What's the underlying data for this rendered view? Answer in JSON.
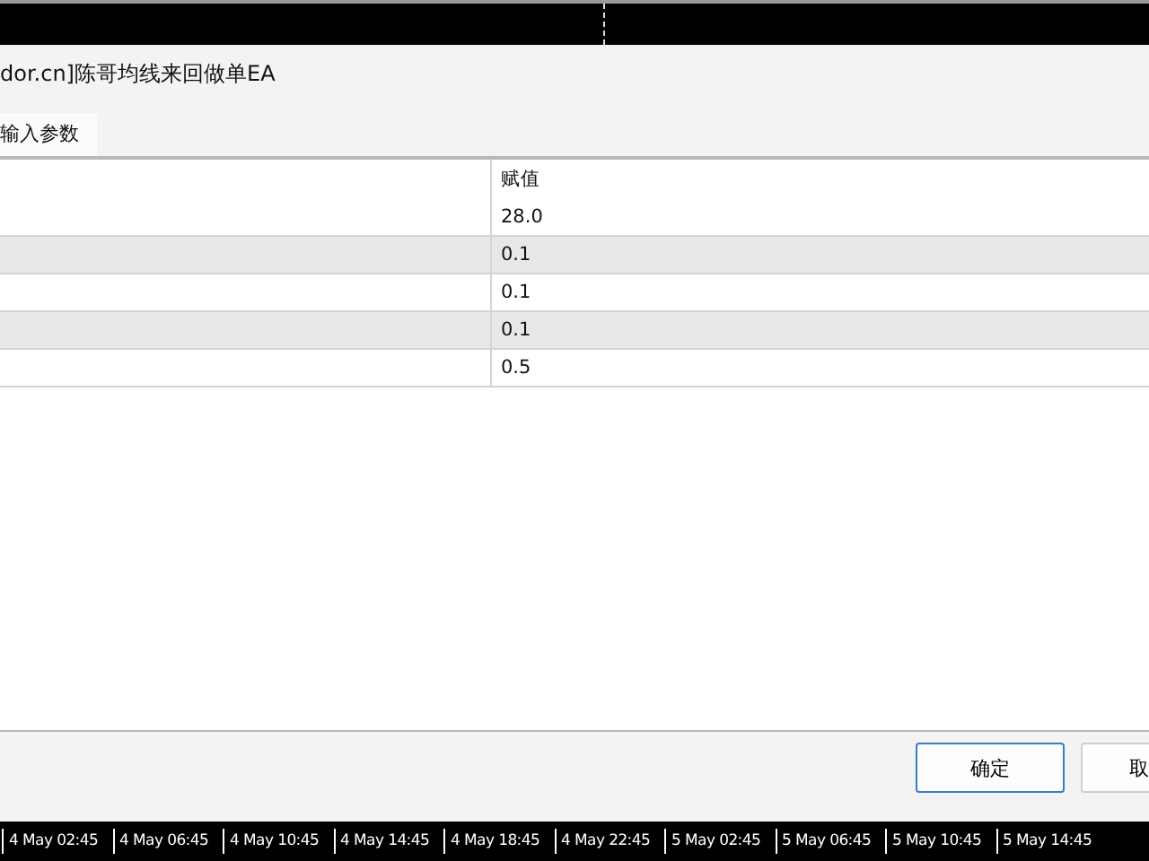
{
  "dialog": {
    "title": "dor.cn]陈哥均线来回做单EA",
    "tabs": [
      {
        "label": "输入参数",
        "selected": true
      }
    ]
  },
  "table": {
    "value_column": "赋值",
    "rows": [
      {
        "value": "28.0"
      },
      {
        "value": "0.1"
      },
      {
        "value": "0.1"
      },
      {
        "value": "0.1"
      },
      {
        "value": "0.5"
      }
    ]
  },
  "buttons": [
    {
      "label": "确定",
      "kind": "default"
    },
    {
      "label": "取",
      "kind": "normal"
    }
  ],
  "time_axis": [
    "4 May 02:45",
    "4 May 06:45",
    "4 May 10:45",
    "4 May 14:45",
    "4 May 18:45",
    "4 May 22:45",
    "5 May 02:45",
    "5 May 06:45",
    "5 May 10:45",
    "5 May 14:45"
  ]
}
